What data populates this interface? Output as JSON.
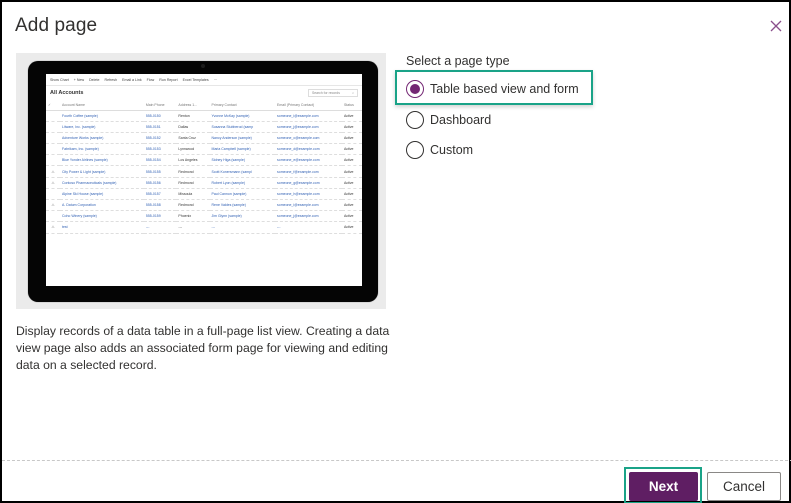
{
  "dialog": {
    "title": "Add page",
    "close_icon": "close-icon",
    "accent_color": "#742774",
    "highlight_color": "#1aa388"
  },
  "preview": {
    "command_bar": [
      "Show Chart",
      "+ New",
      "Delete",
      "Refresh",
      "Email a Link",
      "Flow",
      "Run Report",
      "Excel Templates",
      "···"
    ],
    "view_title": "All Accounts",
    "search_placeholder": "Search for records",
    "columns": [
      "Account Name",
      "Main Phone",
      "Address 1...",
      "Primary Contact",
      "Email (Primary Contact)",
      "Status"
    ],
    "rows": [
      {
        "icon": "",
        "name": "Fourth Coffee (sample)",
        "phone": "555-0150",
        "city": "Renton",
        "contact": "Yvonne McKay (sample)",
        "email": "someone_i@example.com",
        "status": "Active"
      },
      {
        "icon": "",
        "name": "Litware, Inc. (sample)",
        "phone": "555-0151",
        "city": "Dallas",
        "contact": "Susanna Stubberod (samp",
        "email": "someone_j@example.com",
        "status": "Active"
      },
      {
        "icon": "",
        "name": "Adventure Works (sample)",
        "phone": "555-0152",
        "city": "Santa Cruz",
        "contact": "Nancy Anderson (sample)",
        "email": "someone_c@example.com",
        "status": "Active"
      },
      {
        "icon": "",
        "name": "Fabrikam, Inc. (sample)",
        "phone": "555-0153",
        "city": "Lynnwood",
        "contact": "Maria Campbell (sample)",
        "email": "someone_d@example.com",
        "status": "Active"
      },
      {
        "icon": "",
        "name": "Blue Yonder Airlines (sample)",
        "phone": "555-0154",
        "city": "Los Angeles",
        "contact": "Sidney Higa (sample)",
        "email": "someone_e@example.com",
        "status": "Active"
      },
      {
        "icon": "⚠",
        "name": "City Power & Light (sample)",
        "phone": "555-0155",
        "city": "Redmond",
        "contact": "Scott Konersmann (sampl",
        "email": "someone_f@example.com",
        "status": "Active"
      },
      {
        "icon": "⚠",
        "name": "Contoso Pharmaceuticals (sample)",
        "phone": "555-0156",
        "city": "Redmond",
        "contact": "Robert Lyon (sample)",
        "email": "someone_g@example.com",
        "status": "Active"
      },
      {
        "icon": "",
        "name": "Alpine Ski House (sample)",
        "phone": "555-0157",
        "city": "Missoula",
        "contact": "Paul Cannon (sample)",
        "email": "someone_h@example.com",
        "status": "Active"
      },
      {
        "icon": "⚠",
        "name": "A. Datum Corporation",
        "phone": "555-0158",
        "city": "Redmond",
        "contact": "Rene Valdes (sample)",
        "email": "someone_i@example.com",
        "status": "Active"
      },
      {
        "icon": "",
        "name": "Coho Winery (sample)",
        "phone": "555-0159",
        "city": "Phoenix",
        "contact": "Jim Glynn (sample)",
        "email": "someone_j@example.com",
        "status": "Active"
      },
      {
        "icon": "⚠",
        "name": "test",
        "phone": "---",
        "city": "---",
        "contact": "---",
        "email": "---",
        "status": "Active"
      }
    ]
  },
  "description": "Display records of a data table in a full-page list view. Creating a data view page also adds an associated form page for viewing and editing data on a selected record.",
  "page_type": {
    "label": "Select a page type",
    "selected": "Table based view and form",
    "options": [
      {
        "label": "Table based view and form",
        "checked": true
      },
      {
        "label": "Dashboard",
        "checked": false
      },
      {
        "label": "Custom",
        "checked": false
      }
    ]
  },
  "footer": {
    "next_label": "Next",
    "cancel_label": "Cancel"
  }
}
